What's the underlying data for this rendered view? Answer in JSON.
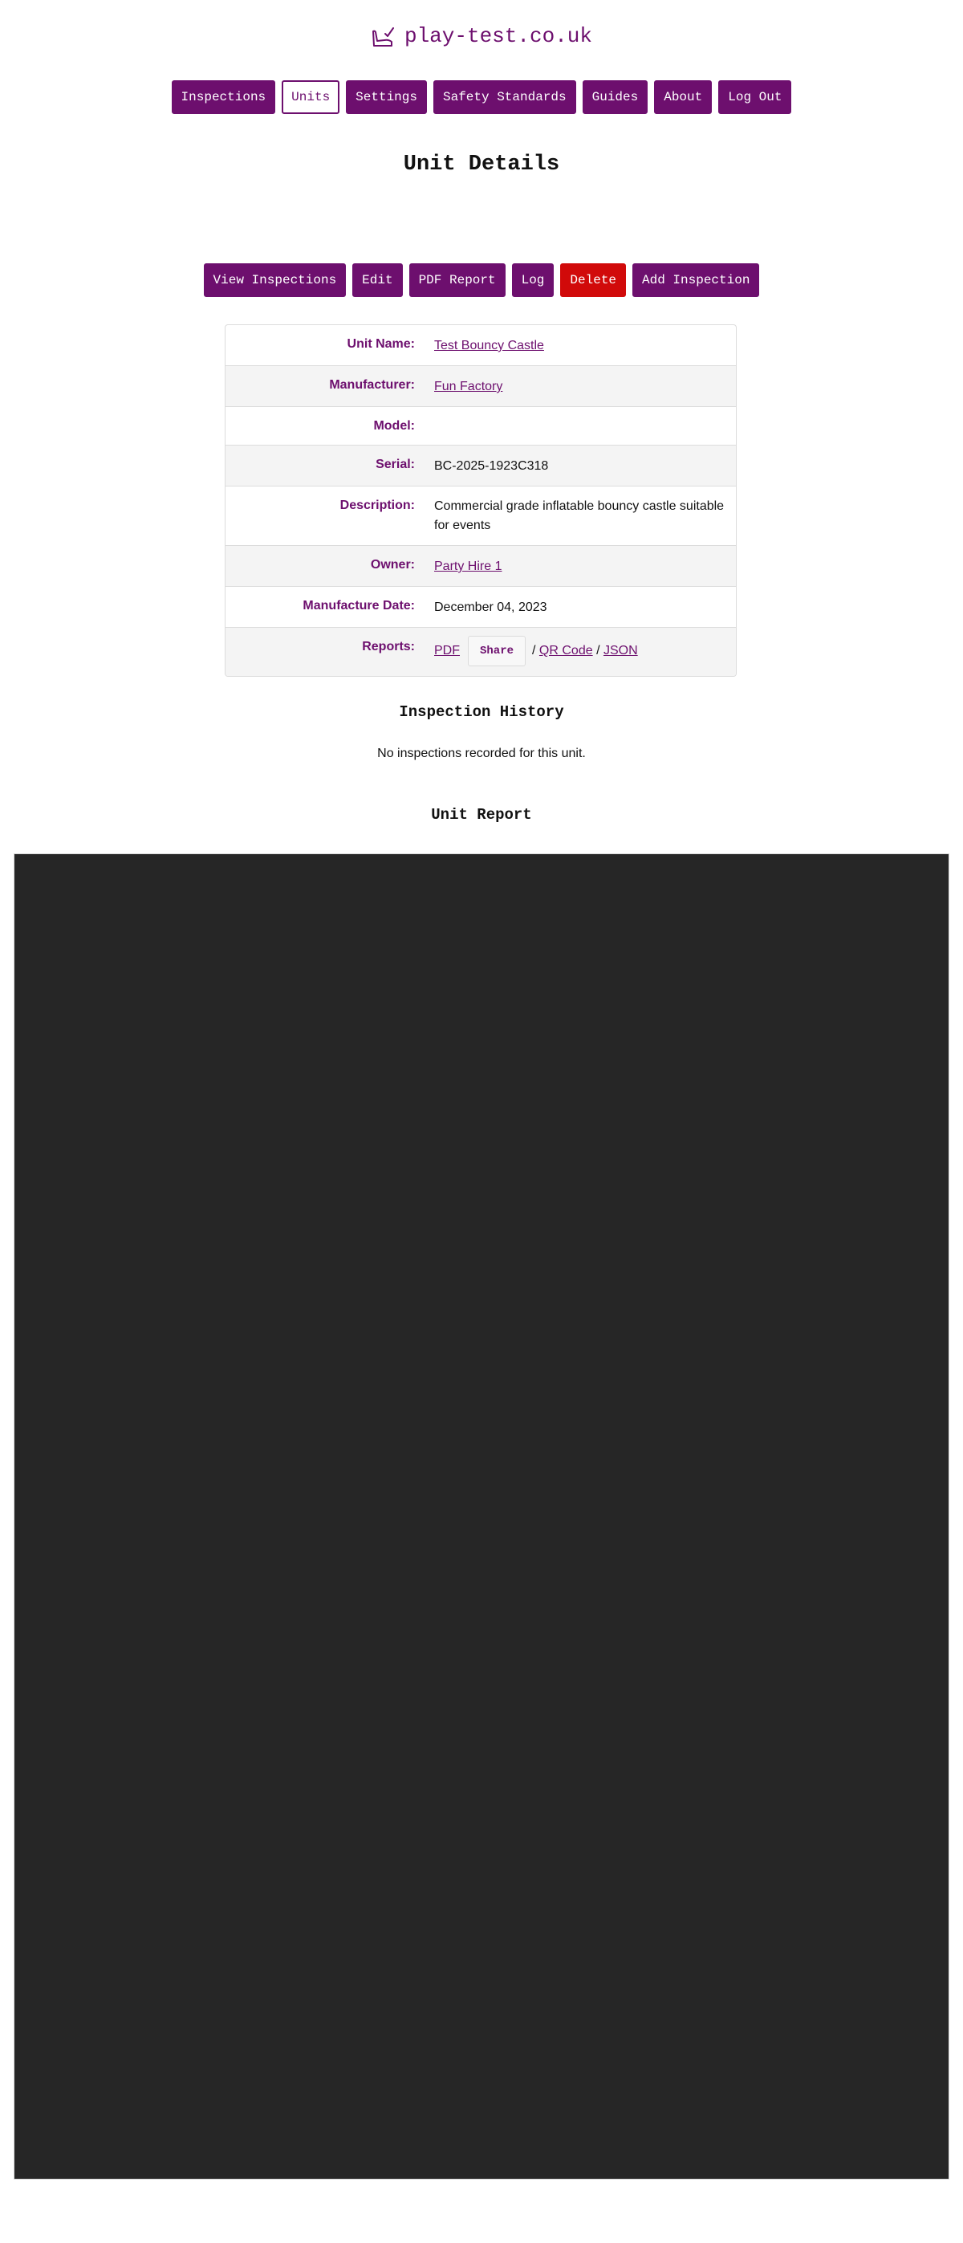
{
  "brand": {
    "name": "play-test.co.uk",
    "icon": "inspector-icon"
  },
  "nav": {
    "items": [
      {
        "label": "Inspections",
        "active": false
      },
      {
        "label": "Units",
        "active": true
      },
      {
        "label": "Settings",
        "active": false
      },
      {
        "label": "Safety Standards",
        "active": false
      },
      {
        "label": "Guides",
        "active": false
      },
      {
        "label": "About",
        "active": false
      },
      {
        "label": "Log Out",
        "active": false
      }
    ]
  },
  "page": {
    "title": "Unit Details"
  },
  "actions": {
    "view_inspections": "View Inspections",
    "edit": "Edit",
    "pdf_report": "PDF Report",
    "log": "Log",
    "delete": "Delete",
    "add_inspection": "Add Inspection"
  },
  "details": {
    "unit_name": {
      "label": "Unit Name:",
      "value": "Test Bouncy Castle"
    },
    "manufacturer": {
      "label": "Manufacturer:",
      "value": "Fun Factory"
    },
    "model": {
      "label": "Model:",
      "value": ""
    },
    "serial": {
      "label": "Serial:",
      "value": "BC-2025-1923C318"
    },
    "description": {
      "label": "Description:",
      "value": "Commercial grade inflatable bouncy castle suitable for events"
    },
    "owner": {
      "label": "Owner:",
      "value": "Party Hire 1"
    },
    "manufacture_date": {
      "label": "Manufacture Date:",
      "value": "December 04, 2023"
    },
    "reports": {
      "label": "Reports:",
      "pdf": "PDF",
      "share": "Share",
      "sep": "/",
      "qr": "QR Code",
      "json": "JSON"
    }
  },
  "history": {
    "title": "Inspection History",
    "empty": "No inspections recorded for this unit."
  },
  "report": {
    "title": "Unit Report"
  },
  "colors": {
    "brand": "#6d0f6e",
    "danger": "#d10a0a",
    "report_bg": "#262626"
  }
}
